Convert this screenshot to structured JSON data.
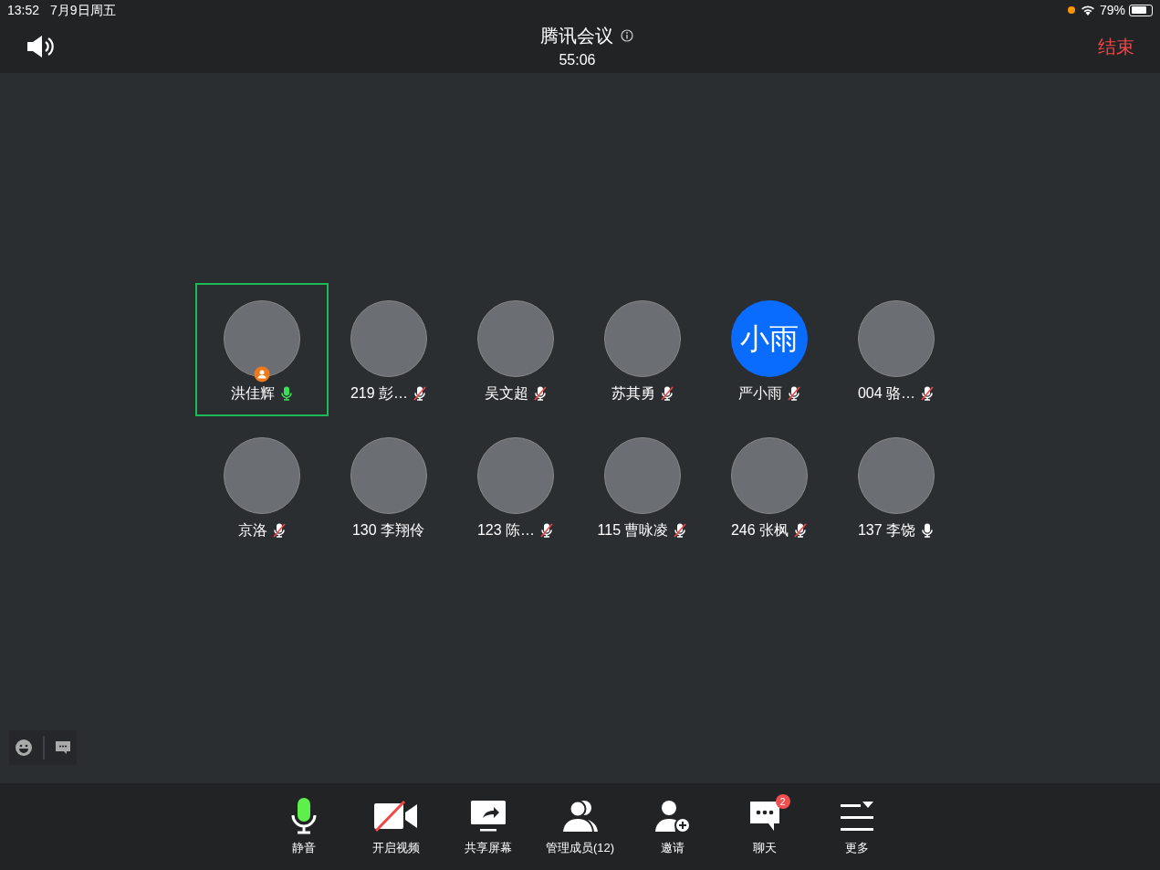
{
  "status_bar": {
    "time": "13:52",
    "date": "7月9日周五",
    "battery": "79%"
  },
  "header": {
    "title": "腾讯会议",
    "duration": "55:06",
    "end_button": "结束"
  },
  "participants": [
    {
      "name": "洪佳辉",
      "kind": "photo",
      "mic_icon": true,
      "muted": false,
      "speaking": true,
      "selected": true,
      "host": true
    },
    {
      "name": "219 彭…",
      "kind": "photo",
      "mic_icon": true,
      "muted": true,
      "speaking": false,
      "selected": false,
      "host": false
    },
    {
      "name": "吴文超",
      "kind": "photo",
      "mic_icon": true,
      "muted": true,
      "speaking": false,
      "selected": false,
      "host": false
    },
    {
      "name": "苏其勇",
      "kind": "photo",
      "mic_icon": true,
      "muted": true,
      "speaking": false,
      "selected": false,
      "host": false
    },
    {
      "name": "严小雨",
      "kind": "initials",
      "initials": "小雨",
      "mic_icon": true,
      "muted": true,
      "speaking": false,
      "selected": false,
      "host": false
    },
    {
      "name": "004 骆…",
      "kind": "photo",
      "mic_icon": true,
      "muted": true,
      "speaking": false,
      "selected": false,
      "host": false
    },
    {
      "name": "京洛",
      "kind": "photo",
      "mic_icon": true,
      "muted": true,
      "speaking": false,
      "selected": false,
      "host": false
    },
    {
      "name": "130 李翔伶",
      "kind": "photo",
      "mic_icon": false,
      "selected": false,
      "host": false
    },
    {
      "name": "123 陈…",
      "kind": "photo",
      "mic_icon": true,
      "muted": true,
      "speaking": false,
      "selected": false,
      "host": false
    },
    {
      "name": "115 曹咏凌",
      "kind": "photo",
      "mic_icon": true,
      "muted": true,
      "speaking": false,
      "selected": false,
      "host": false
    },
    {
      "name": "246 张枫",
      "kind": "photo",
      "mic_icon": true,
      "muted": true,
      "speaking": false,
      "selected": false,
      "host": false
    },
    {
      "name": "137 李饶",
      "kind": "photo",
      "mic_icon": true,
      "muted": false,
      "speaking": false,
      "selected": false,
      "host": false
    }
  ],
  "toolbar": [
    {
      "kind": "mic",
      "label": "静音",
      "on": true
    },
    {
      "kind": "video",
      "label": "开启视频"
    },
    {
      "kind": "share",
      "label": "共享屏幕"
    },
    {
      "kind": "members",
      "label": "管理成员(12)"
    },
    {
      "kind": "invite",
      "label": "邀请"
    },
    {
      "kind": "chat",
      "label": "聊天",
      "badge": "2"
    },
    {
      "kind": "more",
      "label": "更多"
    }
  ]
}
